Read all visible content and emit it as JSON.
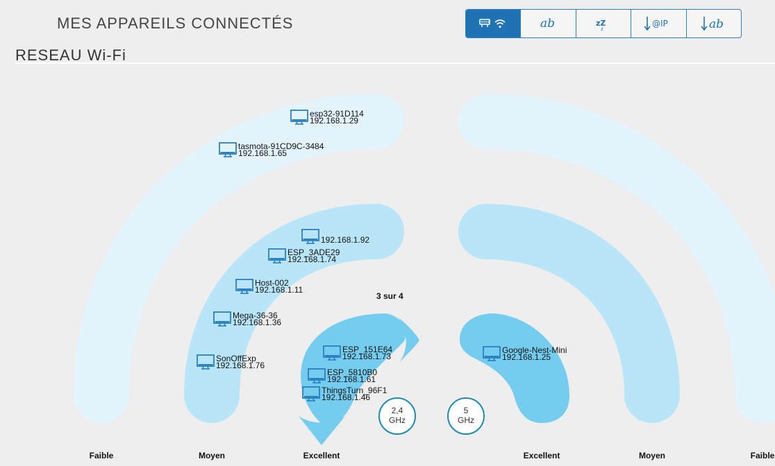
{
  "header": {
    "title": "MES APPAREILS CONNECTÉS",
    "section": "RESEAU Wi-Fi"
  },
  "toolbar": {
    "buttons": [
      {
        "icon": "network-wifi-icon",
        "active": true
      },
      {
        "icon": "sort-alpha-icon",
        "label": "ab",
        "active": false
      },
      {
        "icon": "sleep-icon",
        "label": "zZ",
        "active": false
      },
      {
        "icon": "sort-ip-icon",
        "label": "@IP",
        "active": false
      },
      {
        "icon": "sort-desc-alpha-icon",
        "label": "ab",
        "active": false
      }
    ]
  },
  "colors": {
    "faible": "#e3f4fc",
    "moyen": "#b9e5f8",
    "excellent": "#74cdef",
    "accent": "#1f73b4",
    "device_icon": "#2a7fbf"
  },
  "pagination": "3 sur 4",
  "bands": [
    {
      "line1": "2,4",
      "line2": "GHz"
    },
    {
      "line1": "5",
      "line2": "GHz"
    }
  ],
  "quality_labels": [
    "Faible",
    "Moyen",
    "Excellent",
    "Excellent",
    "Moyen",
    "Faible"
  ],
  "devices": [
    {
      "band": "2.4",
      "quality": "Faible",
      "name": "esp32-91D114",
      "ip": "192.168.1.29"
    },
    {
      "band": "2.4",
      "quality": "Faible",
      "name": "tasmota-91CD9C-3484",
      "ip": "192.168.1.65"
    },
    {
      "band": "2.4",
      "quality": "Moyen",
      "name": "",
      "ip": "192.168.1.92"
    },
    {
      "band": "2.4",
      "quality": "Moyen",
      "name": "ESP_3ADE29",
      "ip": "192.168.1.74"
    },
    {
      "band": "2.4",
      "quality": "Moyen",
      "name": "Host-002",
      "ip": "192.168.1.11"
    },
    {
      "band": "2.4",
      "quality": "Moyen",
      "name": "Mega-36-36",
      "ip": "192.168.1.36"
    },
    {
      "band": "2.4",
      "quality": "Moyen",
      "name": "SonOffExp",
      "ip": "192.168.1.76"
    },
    {
      "band": "2.4",
      "quality": "Excellent",
      "name": "ESP_151E64",
      "ip": "192.168.1.73"
    },
    {
      "band": "2.4",
      "quality": "Excellent",
      "name": "ESP_5810B0",
      "ip": "192.168.1.61"
    },
    {
      "band": "2.4",
      "quality": "Excellent",
      "name": "ThingsTurn_96F1",
      "ip": "192.168.1.46"
    },
    {
      "band": "5",
      "quality": "Excellent",
      "name": "Google-Nest-Mini",
      "ip": "192.168.1.25"
    }
  ]
}
